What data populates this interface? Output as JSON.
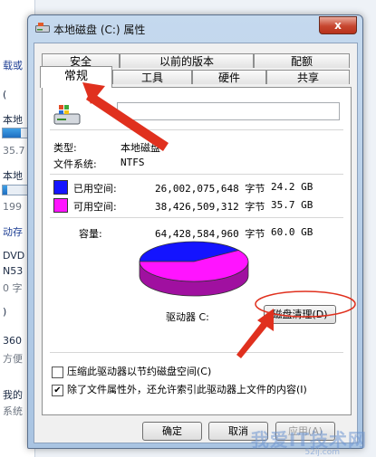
{
  "background_window": {
    "fragments": [
      "载或",
      "(",
      "本地",
      "35.7",
      "本地",
      "199",
      "动存",
      "DVD",
      "N53",
      "0 字",
      ")",
      "360",
      "方便",
      "我的",
      "系统"
    ]
  },
  "dialog": {
    "title": "本地磁盘 (C:) 属性",
    "close_symbol": "x",
    "tabs_top": [
      "安全",
      "以前的版本",
      "配额"
    ],
    "tabs_bottom": [
      "常规",
      "工具",
      "硬件",
      "共享"
    ],
    "general": {
      "name_value": "",
      "type_label": "类型:",
      "type_value": "本地磁盘",
      "fs_label": "文件系统:",
      "fs_value": "NTFS",
      "used_label": "已用空间:",
      "used_bytes": "26,002,075,648 字节",
      "used_gb": "24.2 GB",
      "free_label": "可用空间:",
      "free_bytes": "38,426,509,312 字节",
      "free_gb": "35.7 GB",
      "capacity_label": "容量:",
      "capacity_bytes": "64,428,584,960 字节",
      "capacity_gb": "60.0 GB",
      "drive_label": "驱动器 C:",
      "cleanup_button": "磁盘清理(D)",
      "compress_label": "压缩此驱动器以节约磁盘空间(C)",
      "compress_checked": false,
      "index_label": "除了文件属性外，还允许索引此驱动器上文件的内容(I)",
      "index_checked": true,
      "used_fraction": 0.404
    },
    "buttons": {
      "ok": "确定",
      "cancel": "取消",
      "apply": "应用(A)"
    }
  },
  "colors": {
    "used": "#1414ff",
    "free": "#ff14ff",
    "annotation": "#e0301e"
  },
  "watermark": {
    "text": "我爱IT技术网",
    "sub": "52ij.com"
  }
}
